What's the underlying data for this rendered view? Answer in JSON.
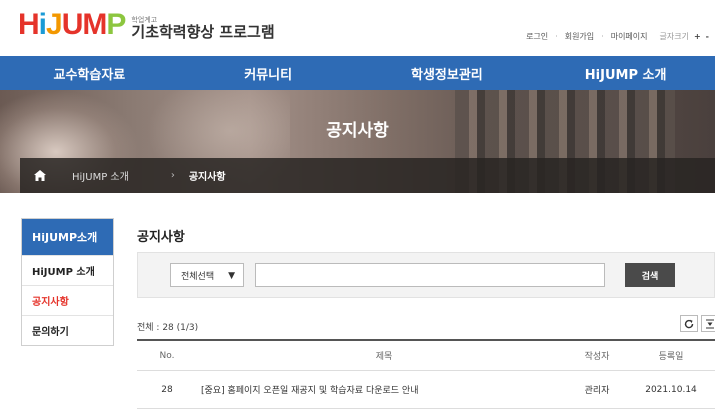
{
  "header": {
    "logo": {
      "word": "HiJUMP",
      "sub_small": "학업계고",
      "sub_big": "기초학력향상 프로그램"
    },
    "util": {
      "login": "로그인",
      "signup": "회원가입",
      "mypage": "마이페이지",
      "fontsize_label": "글자크기",
      "plus": "+",
      "minus": "-"
    }
  },
  "nav": {
    "items": [
      "교수학습자료",
      "커뮤니티",
      "학생정보관리",
      "HiJUMP 소개"
    ]
  },
  "banner": {
    "title": "공지사항"
  },
  "breadcrumb": {
    "home_icon": "home-icon",
    "section": "HiJUMP 소개",
    "current": "공지사항"
  },
  "sidebar": {
    "title": "HiJUMP소개",
    "items": [
      {
        "label": "HiJUMP 소개",
        "active": false
      },
      {
        "label": "공지사항",
        "active": true
      },
      {
        "label": "문의하기",
        "active": false
      }
    ]
  },
  "main": {
    "title": "공지사항",
    "search": {
      "select_value": "전체선택",
      "input_value": "",
      "button": "검색"
    },
    "total": "전체 : 28 (1/3)",
    "tools": {
      "refresh_icon": "refresh-icon",
      "download_icon": "download-icon"
    },
    "table": {
      "headers": {
        "no": "No.",
        "title": "제목",
        "writer": "작성자",
        "date": "등록일"
      },
      "rows": [
        {
          "no": "28",
          "title": "[중요] 홈페이지 오픈일 재공지 및 학습자료 다운로드 안내",
          "writer": "관리자",
          "date": "2021.10.14"
        }
      ]
    }
  },
  "colors": {
    "nav_blue": "#2e6bb5",
    "accent_red": "#e5332a",
    "search_button": "#4a4a4a"
  }
}
